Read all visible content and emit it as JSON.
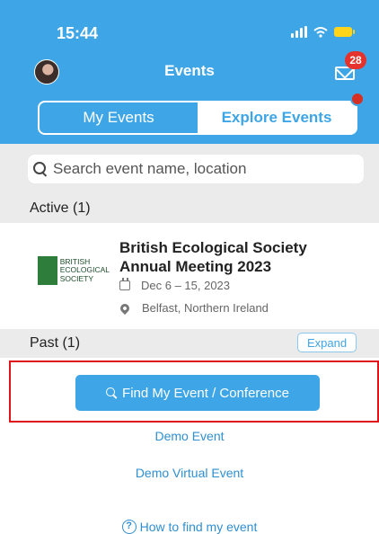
{
  "status_bar": {
    "time": "15:44"
  },
  "header": {
    "title": "Events",
    "mail_badge": "28",
    "tabs": [
      {
        "label": "My Events",
        "active": true
      },
      {
        "label": "Explore Events",
        "active": false
      }
    ]
  },
  "search": {
    "placeholder": "Search event name, location"
  },
  "sections": {
    "active": "Active (1)",
    "past": "Past (1)",
    "expand_label": "Expand"
  },
  "events": [
    {
      "logo_text": [
        "BRITISH",
        "ECOLOGICAL",
        "SOCIETY"
      ],
      "title": "British Ecological Society Annual Meeting 2023",
      "dates": "Dec 6 – 15, 2023",
      "location": "Belfast, Northern Ireland"
    }
  ],
  "actions": {
    "find_button": "Find My Event / Conference",
    "demo_event": "Demo Event",
    "demo_virtual_event": "Demo Virtual Event",
    "help_link": "How to find my event"
  },
  "colors": {
    "accent": "#3ea6e6",
    "badge": "#e5322d",
    "highlight": "#e0151b"
  }
}
